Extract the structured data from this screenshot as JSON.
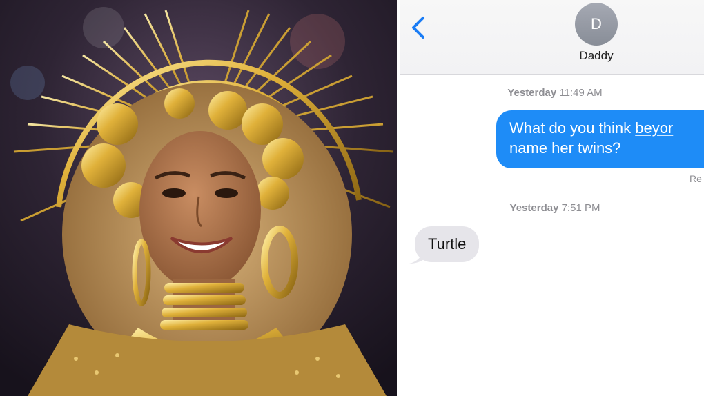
{
  "conversation": {
    "contact_initial": "D",
    "contact_name": "Daddy",
    "back_icon": "chevron-left-icon",
    "messages": [
      {
        "timestamp_day": "Yesterday",
        "timestamp_time": "11:49 AM",
        "direction": "outgoing",
        "line1_prefix": "What do you think ",
        "line1_link": "beyor",
        "line2": "name her twins?",
        "receipt": "Re"
      },
      {
        "timestamp_day": "Yesterday",
        "timestamp_time": "7:51 PM",
        "direction": "incoming",
        "text": "Turtle"
      }
    ]
  },
  "colors": {
    "outgoing_bubble": "#1e8cf7",
    "incoming_bubble": "#e6e5ea",
    "accent": "#1a7cf5"
  }
}
